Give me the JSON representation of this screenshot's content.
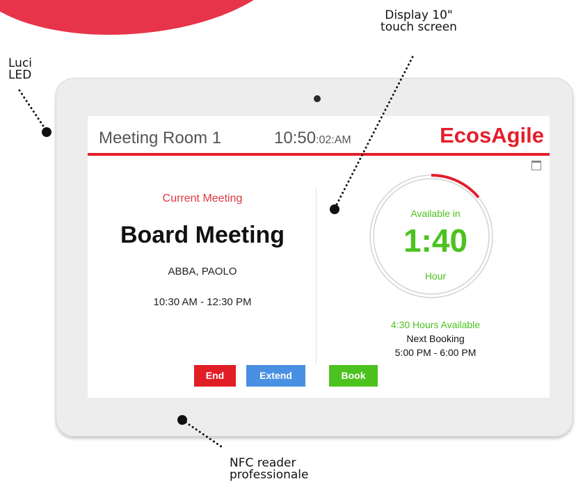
{
  "callouts": {
    "led": [
      "Luci",
      "LED"
    ],
    "display": [
      "Display 10\"",
      "touch screen"
    ],
    "nfc": [
      "NFC  reader",
      "professionale"
    ]
  },
  "screen": {
    "room_name": "Meeting Room 1",
    "clock_main": "10:50",
    "clock_suffix": ":02:AM",
    "brand": "EcosAgile",
    "current_label": "Current Meeting",
    "meeting_title": "Board Meeting",
    "organizer": "ABBA, PAOLO",
    "meeting_time": "10:30 AM - 12:30 PM",
    "available_label": "Available in",
    "countdown": "1:40",
    "countdown_unit": "Hour",
    "hours_available": "4:30 Hours Available",
    "next_booking_label": "Next Booking",
    "next_booking_time": "5:00 PM - 6:00 PM",
    "progress_fraction": 0.14
  },
  "buttons": {
    "end": "End",
    "extend": "Extend",
    "book": "Book"
  },
  "colors": {
    "brand_red": "#e41e2b",
    "available_green": "#4cc21f",
    "extend_blue": "#4a90e2"
  },
  "icons": [
    "calendar-icon",
    "camera-icon"
  ]
}
